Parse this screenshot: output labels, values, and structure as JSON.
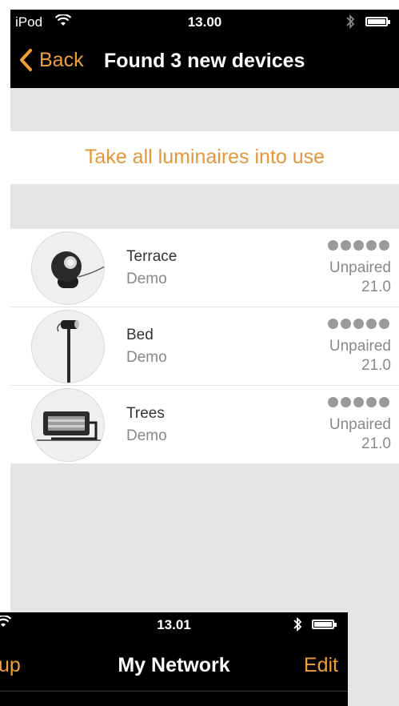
{
  "status_bar": {
    "carrier": "iPod",
    "time": "13.00"
  },
  "nav": {
    "back_label": "Back",
    "title": "Found 3 new devices"
  },
  "action": {
    "label": "Take all luminaires into use"
  },
  "devices": [
    {
      "name": "Terrace",
      "group": "Demo",
      "state": "Unpaired",
      "value": "21.0",
      "icon": "spot-lamp-icon"
    },
    {
      "name": "Bed",
      "group": "Demo",
      "state": "Unpaired",
      "value": "21.0",
      "icon": "garden-spike-light-icon"
    },
    {
      "name": "Trees",
      "group": "Demo",
      "state": "Unpaired",
      "value": "21.0",
      "icon": "floodlight-icon"
    }
  ],
  "second_screen": {
    "time": "13.01",
    "left_label": "up",
    "title": "My Network",
    "edit_label": "Edit"
  },
  "colors": {
    "accent": "#f0a030",
    "action_text": "#e3963a",
    "background": "#e5e5e5"
  }
}
